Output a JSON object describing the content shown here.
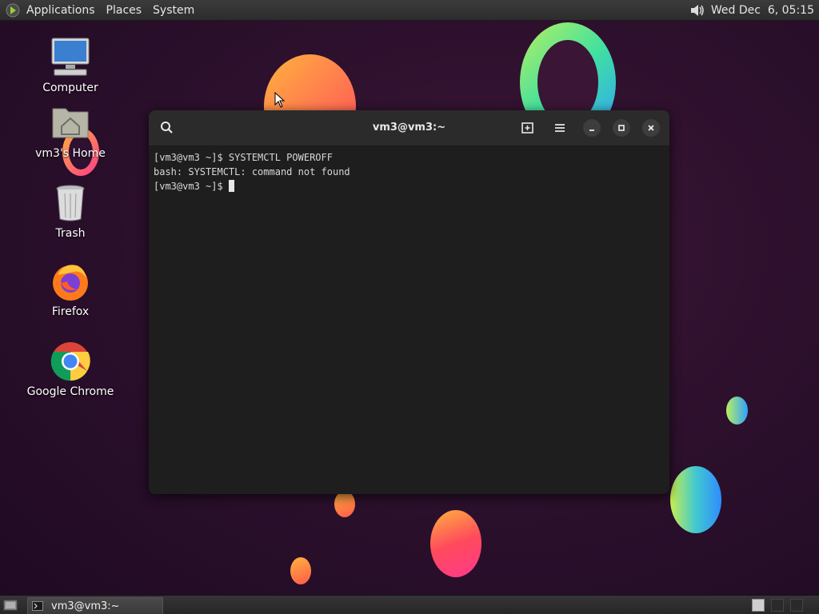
{
  "top_panel": {
    "menus": [
      "Applications",
      "Places",
      "System"
    ],
    "clock": "Wed Dec  6, 05:15",
    "icons": [
      "gnome-foot-icon",
      "volume-icon"
    ]
  },
  "desktop": {
    "icons": [
      {
        "label": "Computer",
        "icon": "computer-icon"
      },
      {
        "label": "vm3's Home",
        "icon": "home-folder-icon"
      },
      {
        "label": "Trash",
        "icon": "trash-icon"
      },
      {
        "label": "Firefox",
        "icon": "firefox-icon"
      },
      {
        "label": "Google Chrome",
        "icon": "chrome-icon"
      }
    ]
  },
  "terminal": {
    "title": "vm3@vm3:~",
    "lines": [
      "[vm3@vm3 ~]$ SYSTEMCTL POWEROFF",
      "bash: SYSTEMCTL: command not found",
      "[vm3@vm3 ~]$ "
    ],
    "toolbar_icons": [
      "search-icon",
      "new-tab-icon",
      "menu-icon",
      "minimize-icon",
      "maximize-icon",
      "close-icon"
    ]
  },
  "bottom_panel": {
    "task_label": "vm3@vm3:~",
    "icons": [
      "show-desktop-icon",
      "terminal-icon",
      "workspace-switcher-icon"
    ]
  },
  "colors": {
    "wallpaper": "#2a0f2b",
    "terminal_bg": "#1e1e1e",
    "titlebar_bg": "#2b2b2b",
    "panel_bg": "#2c2c2c"
  }
}
